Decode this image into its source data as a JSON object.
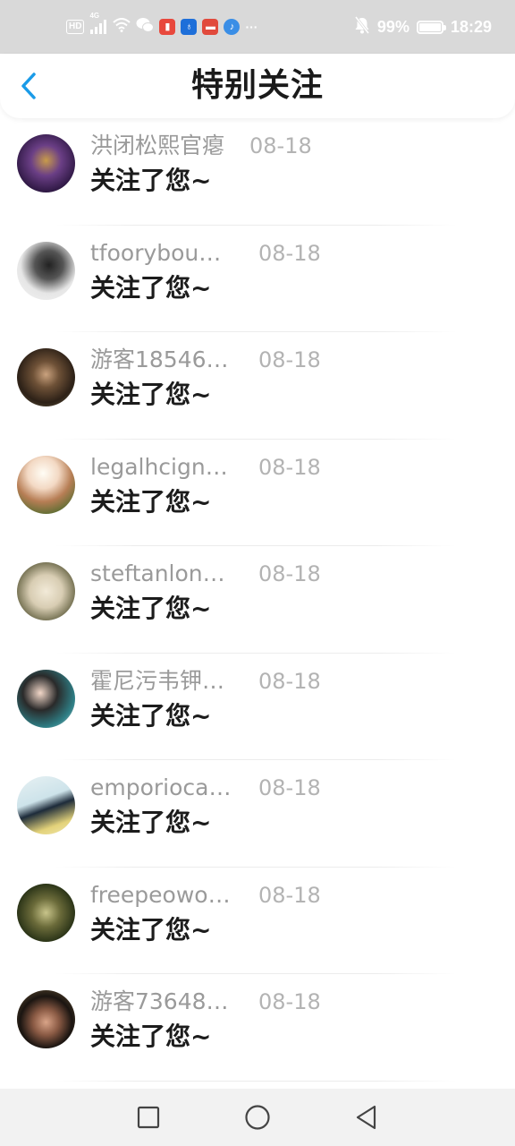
{
  "status_bar": {
    "hd_label": "HD",
    "network_label": "4G",
    "battery_text": "99%",
    "battery_level": 0.99,
    "time": "18:29",
    "more_glyph": "···",
    "notification_icons": [
      "wechat-icon",
      "book-app-icon",
      "bulb-app-icon",
      "huawei-app-icon",
      "music-app-icon"
    ]
  },
  "header": {
    "title": "特别关注",
    "back_icon": "chevron-left-icon",
    "accent_color": "#1a9be8"
  },
  "list": {
    "items": [
      {
        "name": "洪闭松熙官瘪",
        "date": "08-18",
        "message": "关注了您~",
        "avatar": "avatar-1"
      },
      {
        "name": "tfoorybou…",
        "date": "08-18",
        "message": "关注了您~",
        "avatar": "avatar-2"
      },
      {
        "name": "游客18546…",
        "date": "08-18",
        "message": "关注了您~",
        "avatar": "avatar-3"
      },
      {
        "name": "legalhcign…",
        "date": "08-18",
        "message": "关注了您~",
        "avatar": "avatar-4"
      },
      {
        "name": "steftanlon…",
        "date": "08-18",
        "message": "关注了您~",
        "avatar": "avatar-5"
      },
      {
        "name": "霍尼污韦钾…",
        "date": "08-18",
        "message": "关注了您~",
        "avatar": "avatar-6"
      },
      {
        "name": "emporioca…",
        "date": "08-18",
        "message": "关注了您~",
        "avatar": "avatar-7"
      },
      {
        "name": "freepeowo…",
        "date": "08-18",
        "message": "关注了您~",
        "avatar": "avatar-8"
      },
      {
        "name": "游客73648…",
        "date": "08-18",
        "message": "关注了您~",
        "avatar": "avatar-9"
      }
    ]
  },
  "nav_bar": {
    "buttons": [
      "recent-apps-icon",
      "home-icon",
      "back-icon"
    ]
  }
}
